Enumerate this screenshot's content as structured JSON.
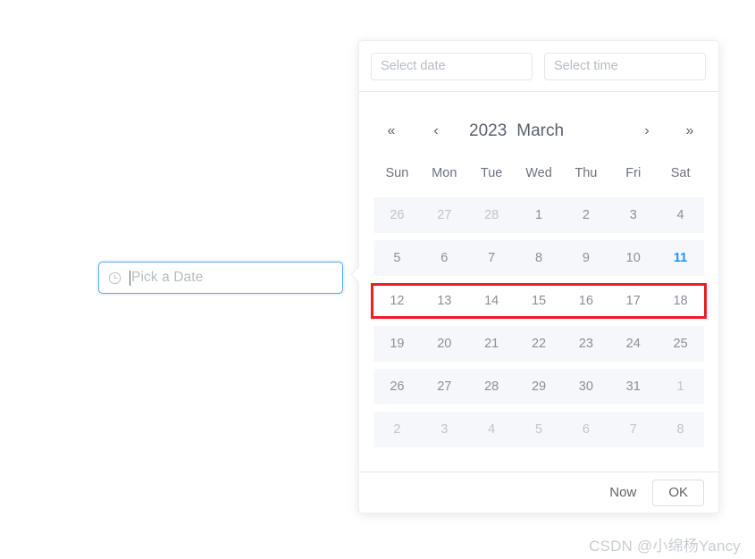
{
  "trigger": {
    "icon": "clock-icon",
    "placeholder": "Pick a Date",
    "focus_color": "#5aa8f0"
  },
  "panel": {
    "date_field": {
      "placeholder": "Select date",
      "value": ""
    },
    "time_field": {
      "placeholder": "Select time",
      "value": ""
    },
    "nav": {
      "prev_year": "«",
      "prev_month": "‹",
      "next_month": "›",
      "next_year": "»"
    },
    "header": {
      "year": "2023",
      "month": "March"
    },
    "weekdays": [
      "Sun",
      "Mon",
      "Tue",
      "Wed",
      "Thu",
      "Fri",
      "Sat"
    ],
    "weeks": [
      {
        "marked": false,
        "days": [
          {
            "label": "26",
            "type": "prev"
          },
          {
            "label": "27",
            "type": "prev"
          },
          {
            "label": "28",
            "type": "prev"
          },
          {
            "label": "1",
            "type": "current"
          },
          {
            "label": "2",
            "type": "current"
          },
          {
            "label": "3",
            "type": "current"
          },
          {
            "label": "4",
            "type": "current"
          }
        ]
      },
      {
        "marked": false,
        "days": [
          {
            "label": "5",
            "type": "current"
          },
          {
            "label": "6",
            "type": "current"
          },
          {
            "label": "7",
            "type": "current"
          },
          {
            "label": "8",
            "type": "current"
          },
          {
            "label": "9",
            "type": "current"
          },
          {
            "label": "10",
            "type": "current"
          },
          {
            "label": "11",
            "type": "today"
          }
        ]
      },
      {
        "marked": true,
        "days": [
          {
            "label": "12",
            "type": "current"
          },
          {
            "label": "13",
            "type": "current"
          },
          {
            "label": "14",
            "type": "current"
          },
          {
            "label": "15",
            "type": "current"
          },
          {
            "label": "16",
            "type": "current"
          },
          {
            "label": "17",
            "type": "current"
          },
          {
            "label": "18",
            "type": "current"
          }
        ]
      },
      {
        "marked": false,
        "days": [
          {
            "label": "19",
            "type": "current"
          },
          {
            "label": "20",
            "type": "current"
          },
          {
            "label": "21",
            "type": "current"
          },
          {
            "label": "22",
            "type": "current"
          },
          {
            "label": "23",
            "type": "current"
          },
          {
            "label": "24",
            "type": "current"
          },
          {
            "label": "25",
            "type": "current"
          }
        ]
      },
      {
        "marked": false,
        "days": [
          {
            "label": "26",
            "type": "current"
          },
          {
            "label": "27",
            "type": "current"
          },
          {
            "label": "28",
            "type": "current"
          },
          {
            "label": "29",
            "type": "current"
          },
          {
            "label": "30",
            "type": "current"
          },
          {
            "label": "31",
            "type": "current"
          },
          {
            "label": "1",
            "type": "next"
          }
        ]
      },
      {
        "marked": false,
        "days": [
          {
            "label": "2",
            "type": "next"
          },
          {
            "label": "3",
            "type": "next"
          },
          {
            "label": "4",
            "type": "next"
          },
          {
            "label": "5",
            "type": "next"
          },
          {
            "label": "6",
            "type": "next"
          },
          {
            "label": "7",
            "type": "next"
          },
          {
            "label": "8",
            "type": "next"
          }
        ]
      }
    ],
    "footer": {
      "now_label": "Now",
      "ok_label": "OK"
    },
    "highlight_color": "#ee1c25",
    "today_color": "#2196f3"
  },
  "watermark": "CSDN @小绵杨Yancy"
}
